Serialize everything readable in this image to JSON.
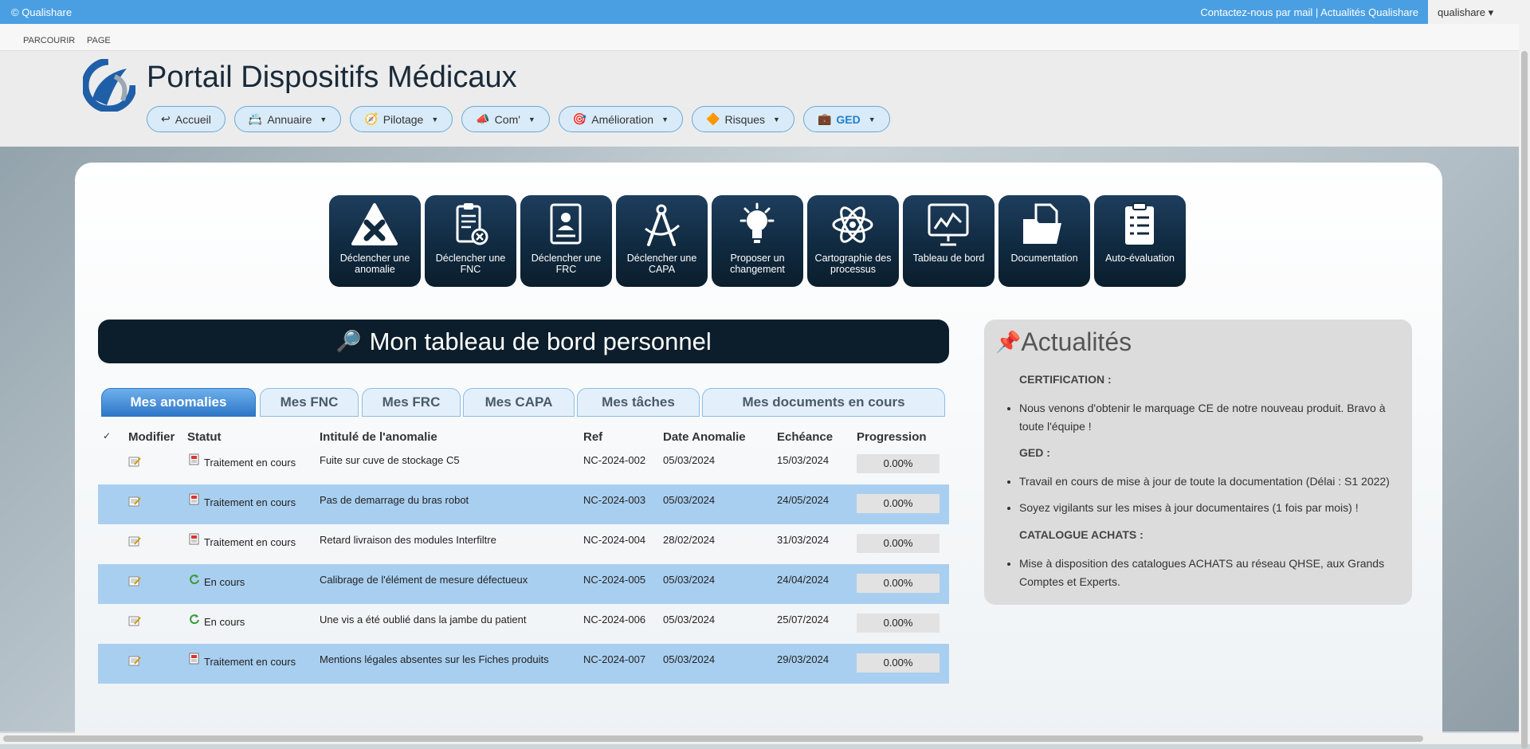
{
  "topbar": {
    "brand": "© Qualishare",
    "links": "Contactez-nous par mail | Actualités Qualishare",
    "user": "qualishare ▾"
  },
  "ribbon": {
    "items": [
      "PARCOURIR",
      "PAGE"
    ]
  },
  "header": {
    "title": "Portail Dispositifs Médicaux"
  },
  "nav": [
    {
      "label": "Accueil",
      "icon": "↩",
      "dropdown": false
    },
    {
      "label": "Annuaire",
      "icon": "📇",
      "dropdown": true
    },
    {
      "label": "Pilotage",
      "icon": "🧭",
      "dropdown": true
    },
    {
      "label": "Com'",
      "icon": "📣",
      "dropdown": true
    },
    {
      "label": "Amélioration",
      "icon": "🎯",
      "dropdown": true
    },
    {
      "label": "Risques",
      "icon": "🔶",
      "dropdown": true
    },
    {
      "label": "GED",
      "icon": "💼",
      "dropdown": true
    }
  ],
  "tiles": [
    {
      "label": "Déclencher une anomalie",
      "icon": "warning-x-icon"
    },
    {
      "label": "Déclencher une FNC",
      "icon": "clipboard-x-icon"
    },
    {
      "label": "Déclencher une FRC",
      "icon": "id-card-icon"
    },
    {
      "label": "Déclencher une CAPA",
      "icon": "compass-icon"
    },
    {
      "label": "Proposer un changement",
      "icon": "lightbulb-icon"
    },
    {
      "label": "Cartographie des processus",
      "icon": "atom-icon"
    },
    {
      "label": "Tableau de bord",
      "icon": "chart-board-icon"
    },
    {
      "label": "Documentation",
      "icon": "folder-icon"
    },
    {
      "label": "Auto-évaluation",
      "icon": "checklist-icon"
    }
  ],
  "dashboard": {
    "title": "Mon tableau de bord personnel",
    "icon": "🔎"
  },
  "tabs": [
    "Mes anomalies",
    "Mes FNC",
    "Mes FRC",
    "Mes CAPA",
    "Mes tâches",
    "Mes documents en cours"
  ],
  "table": {
    "headers": {
      "check": "✓",
      "modifier": "Modifier",
      "statut": "Statut",
      "intitule": "Intitulé de l'anomalie",
      "ref": "Ref",
      "date": "Date Anomalie",
      "echeance": "Echéance",
      "progression": "Progression"
    },
    "rows": [
      {
        "statut": "Traitement en cours",
        "status_icon": "document-red-icon",
        "intitule": "Fuite sur cuve de stockage C5",
        "ref": "NC-2024-002",
        "date": "05/03/2024",
        "echeance": "15/03/2024",
        "progression": "0.00%"
      },
      {
        "statut": "Traitement en cours",
        "status_icon": "document-red-icon",
        "intitule": "Pas de demarrage du bras robot",
        "ref": "NC-2024-003",
        "date": "05/03/2024",
        "echeance": "24/05/2024",
        "progression": "0.00%"
      },
      {
        "statut": "Traitement en cours",
        "status_icon": "document-red-icon",
        "intitule": "Retard livraison des modules Interfiltre",
        "ref": "NC-2024-004",
        "date": "28/02/2024",
        "echeance": "31/03/2024",
        "progression": "0.00%"
      },
      {
        "statut": "En cours",
        "status_icon": "refresh-green-icon",
        "intitule": "Calibrage de l'élément de mesure défectueux",
        "ref": "NC-2024-005",
        "date": "05/03/2024",
        "echeance": "24/04/2024",
        "progression": "0.00%"
      },
      {
        "statut": "En cours",
        "status_icon": "refresh-green-icon",
        "intitule": "Une vis a été oublié dans la jambe du patient",
        "ref": "NC-2024-006",
        "date": "05/03/2024",
        "echeance": "25/07/2024",
        "progression": "0.00%"
      },
      {
        "statut": "Traitement en cours",
        "status_icon": "document-red-icon",
        "intitule": "Mentions légales absentes sur les Fiches produits",
        "ref": "NC-2024-007",
        "date": "05/03/2024",
        "echeance": "29/03/2024",
        "progression": "0.00%"
      }
    ]
  },
  "news": {
    "title": "Actualités",
    "icon": "📌",
    "sections": [
      {
        "heading": "CERTIFICATION :",
        "items": [
          "Nous venons d'obtenir le marquage CE de notre nouveau produit. Bravo à toute l'équipe !"
        ]
      },
      {
        "heading": "GED :",
        "items": [
          "Travail en cours de mise à jour de toute la documentation (Délai : S1 2022)",
          "Soyez vigilants sur les mises à jour documentaires (1 fois par mois) !"
        ]
      },
      {
        "heading": "CATALOGUE ACHATS :",
        "items": [
          "Mise à disposition des catalogues ACHATS au réseau QHSE, aux Grands Comptes et Experts."
        ]
      }
    ]
  },
  "colors": {
    "topbar": "#4a9fe2",
    "tile": "#102a40",
    "row_alt": "#a9cff0",
    "tab_active": "#2d77c8"
  }
}
